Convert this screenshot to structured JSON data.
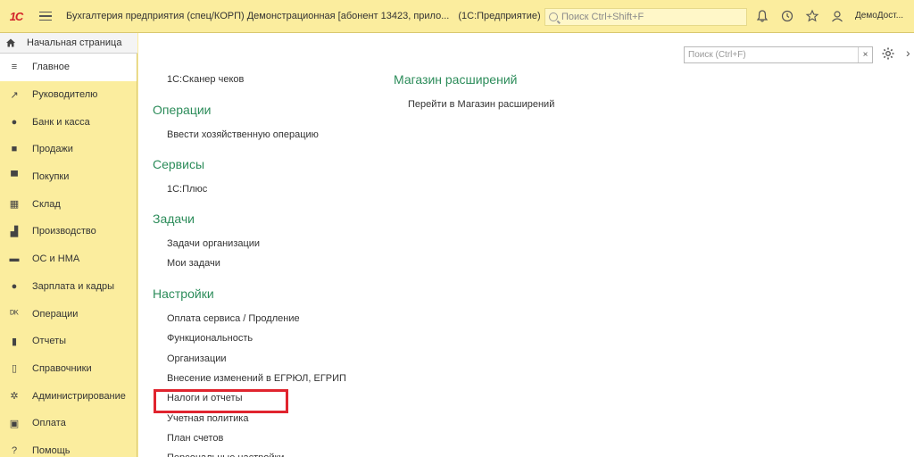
{
  "titlebar": {
    "logo": "1С",
    "title": "Бухгалтерия предприятия (спец/КОРП) Демонстрационная [абонент 13423, прило...",
    "subtitle": "(1С:Предприятие)",
    "search_placeholder": "Поиск Ctrl+Shift+F",
    "user": "ДемоДост..."
  },
  "sidebar": {
    "home": "Начальная страница",
    "items": [
      {
        "label": "Главное",
        "icon": "menu-lines-icon",
        "active": true
      },
      {
        "label": "Руководителю",
        "icon": "trend-icon"
      },
      {
        "label": "Банк и касса",
        "icon": "coin-icon"
      },
      {
        "label": "Продажи",
        "icon": "bag-icon"
      },
      {
        "label": "Покупки",
        "icon": "cart-icon"
      },
      {
        "label": "Склад",
        "icon": "warehouse-icon"
      },
      {
        "label": "Производство",
        "icon": "factory-icon"
      },
      {
        "label": "ОС и НМА",
        "icon": "truck-icon"
      },
      {
        "label": "Зарплата и кадры",
        "icon": "person-icon"
      },
      {
        "label": "Операции",
        "icon": "dt-kt-icon"
      },
      {
        "label": "Отчеты",
        "icon": "bar-chart-icon"
      },
      {
        "label": "Справочники",
        "icon": "books-icon"
      },
      {
        "label": "Администрирование",
        "icon": "gear-icon"
      },
      {
        "label": "Оплата",
        "icon": "payment-icon"
      },
      {
        "label": "Помощь",
        "icon": "question-icon"
      }
    ]
  },
  "panel": {
    "search_placeholder": "Поиск (Ctrl+F)",
    "clear": "×"
  },
  "col1": {
    "top_link": "1С:Сканер чеков",
    "sections": [
      {
        "title": "Операции",
        "links": [
          "Ввести хозяйственную операцию"
        ]
      },
      {
        "title": "Сервисы",
        "links": [
          "1С:Плюс"
        ]
      },
      {
        "title": "Задачи",
        "links": [
          "Задачи организации",
          "Мои задачи"
        ]
      },
      {
        "title": "Настройки",
        "links": [
          "Оплата сервиса / Продление",
          "Функциональность",
          "Организации",
          "Внесение изменений в ЕГРЮЛ, ЕГРИП",
          "Налоги и отчеты",
          "Учетная политика",
          "План счетов",
          "Персональные настройки"
        ]
      }
    ]
  },
  "col2": {
    "sections": [
      {
        "title": "Магазин расширений",
        "links": [
          "Перейти в Магазин расширений"
        ]
      }
    ]
  }
}
